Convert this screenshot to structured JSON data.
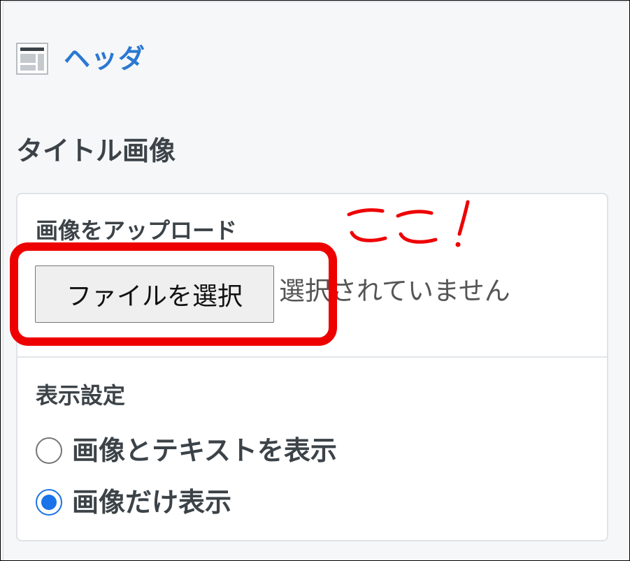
{
  "header": {
    "link_label": "ヘッダ",
    "icon": "layout-header-icon"
  },
  "section": {
    "title": "タイトル画像"
  },
  "upload": {
    "label": "画像をアップロード",
    "button_label": "ファイルを選択",
    "status": "選択されていません"
  },
  "display": {
    "label": "表示設定",
    "options": [
      {
        "label": "画像とテキストを表示",
        "selected": false
      },
      {
        "label": "画像だけ表示",
        "selected": true
      }
    ]
  },
  "annotation": {
    "text": "ここ!",
    "color": "#ee0000"
  },
  "colors": {
    "accent": "#2a78d2",
    "radio_selected": "#1a73e8",
    "highlight": "#ee0000"
  }
}
